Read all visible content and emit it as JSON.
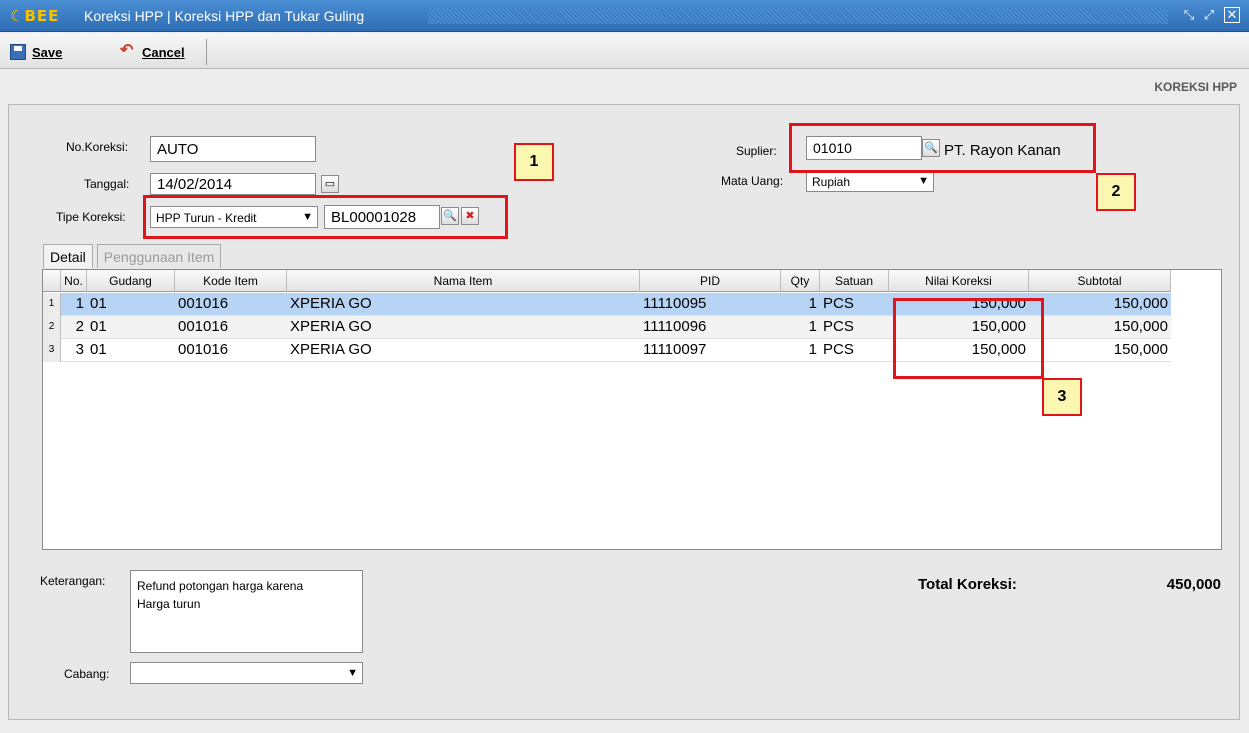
{
  "window": {
    "logo": "BEE",
    "title": "Koreksi HPP | Koreksi HPP dan Tukar Guling"
  },
  "toolbar": {
    "save_label": "Save",
    "cancel_label": "Cancel"
  },
  "page_label": "KOREKSI HPP",
  "form": {
    "no_koreksi_label": "No.Koreksi:",
    "no_koreksi_value": "AUTO",
    "tanggal_label": "Tanggal:",
    "tanggal_value": "14/02/2014",
    "tipe_label": "Tipe Koreksi:",
    "tipe_value": "HPP Turun - Kredit",
    "ref_value": "BL00001028",
    "suplier_label": "Suplier:",
    "suplier_code": "01010",
    "suplier_name": "PT. Rayon Kanan",
    "mata_uang_label": "Mata Uang:",
    "mata_uang_value": "Rupiah"
  },
  "tabs": [
    "Detail",
    "Penggunaan Item"
  ],
  "table": {
    "columns": [
      "No.",
      "Gudang",
      "Kode Item",
      "Nama Item",
      "PID",
      "Qty",
      "Satuan",
      "Nilai Koreksi",
      "Subtotal"
    ],
    "rows": [
      {
        "row_no": "1",
        "no": "1",
        "gudang": "01",
        "kode": "001016",
        "nama": "XPERIA GO",
        "pid": "11110095",
        "qty": "1",
        "satuan": "PCS",
        "nilai": "150,000",
        "subtotal": "150,000"
      },
      {
        "row_no": "2",
        "no": "2",
        "gudang": "01",
        "kode": "001016",
        "nama": "XPERIA GO",
        "pid": "11110096",
        "qty": "1",
        "satuan": "PCS",
        "nilai": "150,000",
        "subtotal": "150,000"
      },
      {
        "row_no": "3",
        "no": "3",
        "gudang": "01",
        "kode": "001016",
        "nama": "XPERIA GO",
        "pid": "11110097",
        "qty": "1",
        "satuan": "PCS",
        "nilai": "150,000",
        "subtotal": "150,000"
      }
    ]
  },
  "footer": {
    "keterangan_label": "Keterangan:",
    "keterangan_value": "Refund potongan harga karena\nHarga turun",
    "cabang_label": "Cabang:",
    "cabang_value": "",
    "total_label": "Total Koreksi:",
    "total_value": "450,000"
  },
  "callouts": [
    "1",
    "2",
    "3"
  ],
  "colors": {
    "title_bar": "#2e6db4",
    "highlight": "#e0141b",
    "callout_bg": "#fbf6b0",
    "selected_row": "#b7d4f5"
  }
}
